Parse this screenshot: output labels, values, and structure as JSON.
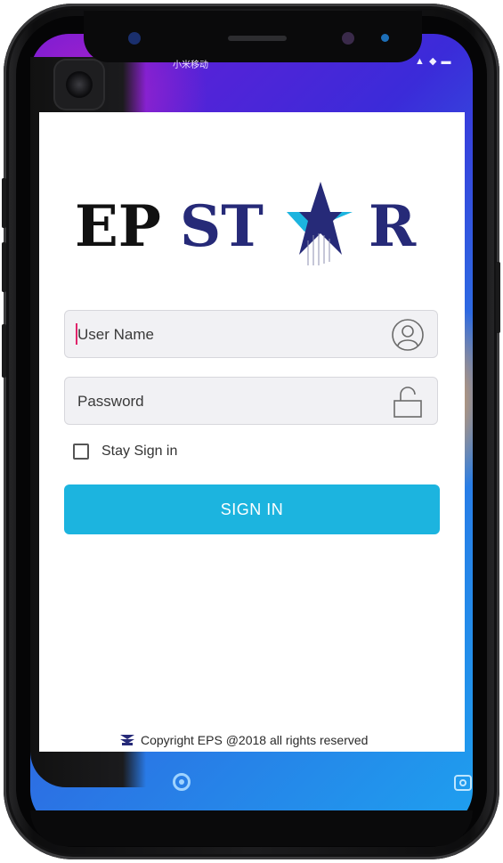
{
  "status_bar": {
    "carrier": "小米移动",
    "signal": "▲ ◆ ▬"
  },
  "logo": {
    "text_part1": "EP",
    "text_part2": "ST",
    "text_part3": "R",
    "colors": {
      "dark": "#111111",
      "navy": "#262a78",
      "cyan": "#1cb4df"
    }
  },
  "form": {
    "username_placeholder": "User Name",
    "password_placeholder": "Password",
    "stay_signin_label": "Stay Sign in",
    "signin_label": "SIGN IN"
  },
  "footer": {
    "copyright": "Copyright EPS @2018 all rights reserved"
  },
  "icons": {
    "user": "user-circle-icon",
    "lock": "lock-icon"
  },
  "theme": {
    "accent": "#1cb4df",
    "field_bg": "#f1f1f4",
    "cursor": "#e0246b"
  }
}
